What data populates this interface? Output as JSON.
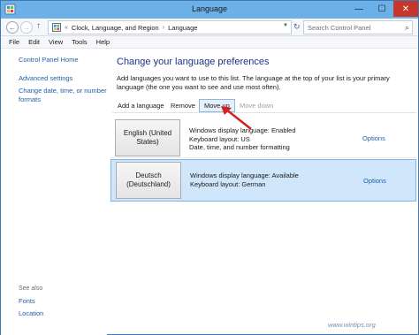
{
  "window": {
    "title": "Language",
    "minimize_glyph": "—",
    "maximize_glyph": "☐",
    "close_glyph": "✕"
  },
  "address": {
    "path": [
      "Clock, Language, and Region",
      "Language"
    ],
    "path_prefix": "«",
    "separator": "›",
    "search_placeholder": "Search Control Panel"
  },
  "menu": [
    "File",
    "Edit",
    "View",
    "Tools",
    "Help"
  ],
  "sidebar": {
    "links": [
      "Control Panel Home",
      "Advanced settings",
      "Change date, time, or number formats"
    ],
    "see_also_label": "See also",
    "see_also_links": [
      "Fonts",
      "Location"
    ]
  },
  "main": {
    "heading": "Change your language preferences",
    "description": "Add languages you want to use to this list. The language at the top of your list is your primary language (the one you want to see and use most often).",
    "toolbar": {
      "add": "Add a language",
      "remove": "Remove",
      "move_up": "Move up",
      "move_down": "Move down"
    },
    "languages": [
      {
        "name": "English (United States)",
        "details": [
          "Windows display language: Enabled",
          "Keyboard layout: US",
          "Date, time, and number formatting"
        ],
        "options": "Options"
      },
      {
        "name": "Deutsch (Deutschland)",
        "details": [
          "Windows display language: Available",
          "Keyboard layout: German"
        ],
        "options": "Options"
      }
    ]
  },
  "watermark": "www.wintips.org",
  "colors": {
    "link": "#1f5fa8",
    "heading": "#1e3287",
    "selected_row": "#cfe6fb",
    "close_button": "#c7362b",
    "arrow": "#d32020"
  }
}
